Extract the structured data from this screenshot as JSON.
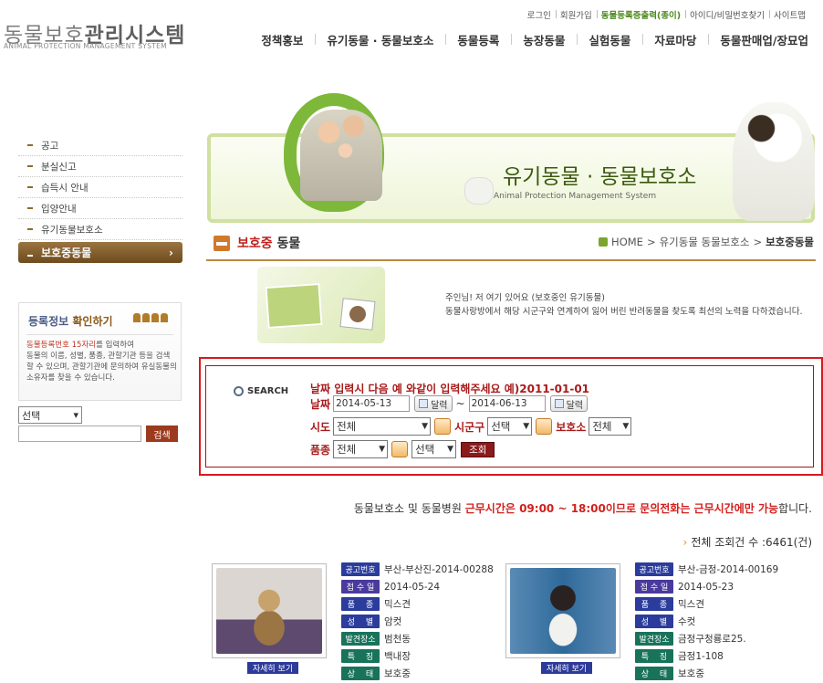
{
  "header": {
    "logo_main_a": "동물보호",
    "logo_main_b": "관리시스템",
    "logo_sub": "ANIMAL PROTECTION MANAGEMENT SYSTEM",
    "util_links": [
      "로그인",
      "회원가입",
      "동물등록증출력(종이)",
      "아이디/비밀번호찾기",
      "사이트맵"
    ],
    "nav": [
      "정책홍보",
      "유기동물 · 동물보호소",
      "동물등록",
      "농장동물",
      "실험동물",
      "자료마당",
      "동물판매업/장묘업"
    ]
  },
  "sidebar": {
    "items": [
      "공고",
      "분실신고",
      "습득시 안내",
      "입양안내",
      "유기동물보호소"
    ],
    "active": "보호중동물",
    "active_arrow": "›",
    "reg_title_a": "등록정보",
    "reg_title_b": "확인하기",
    "reg_line1_red": "동물등록번호 15자리",
    "reg_line1_rest": "를 입력하여",
    "reg_text": "동물의 이름, 성별, 품종, 관할기관 등을 검색할 수 있으며, 관할기관에 문의하여 유실동물의 소유자를 찾을 수 있습니다.",
    "select_value": "선택",
    "search_button": "검색"
  },
  "banner": {
    "title": "유기동물 · 동물보호소",
    "subtitle": "Animal Protection Management System"
  },
  "page": {
    "title_red": "보호중",
    "title_dark": "동물",
    "breadcrumb_home": "HOME",
    "breadcrumb_mid": "유기동물 동물보호소",
    "breadcrumb_current": "보호중동물",
    "intro_line1": "주인님! 저 여기 있어요 (보호중인 유기동물)",
    "intro_line2": "동물사랑방에서 해당 시군구와 연계하여 잃어 버린 반려동물을 찾도록 최선의 노력을 다하겠습니다."
  },
  "search": {
    "label": "SEARCH",
    "hint": "날짜 입력시 다음 예 와같이 입력해주세요 예)2011-01-01",
    "date_label": "날짜",
    "date_from": "2014-05-13",
    "date_to": "2014-06-13",
    "tilde": "~",
    "calendar_button": "달력",
    "sido_label": "시도",
    "sido_value": "전체",
    "sigungu_label": "시군구",
    "sigungu_value": "선택",
    "shelter_label": "보호소",
    "shelter_value": "전체",
    "breed_label": "품종",
    "breed_value": "전체",
    "breed_sub_value": "선택",
    "submit": "조회"
  },
  "notice": {
    "text_a": "동물보호소 및 동물병원 ",
    "text_hl": "근무시간은 09:00 ~ 18:00이므로 문의전화는 근무시간에만 가능",
    "text_b": "합니다."
  },
  "total": {
    "text": "전체 조회건 수 :6461(건)"
  },
  "labels": {
    "notice_no": "공고번호",
    "received": "접 수 일",
    "breed": "품　 종",
    "sex": "성　 별",
    "found": "발견장소",
    "feature": "특　 징",
    "status": "상　 태",
    "detail": "자세히 보기"
  },
  "animals": [
    {
      "notice_no": "부산-부산진-2014-00288",
      "received": "2014-05-24",
      "breed": "믹스견",
      "sex": "암컷",
      "found": "범천동",
      "feature": "백내장",
      "status": "보호중"
    },
    {
      "notice_no": "부산-금정-2014-00169",
      "received": "2014-05-23",
      "breed": "믹스견",
      "sex": "수컷",
      "found": "금정구청룡로25.",
      "feature": "금정1-108",
      "status": "보호중"
    }
  ],
  "colors": {
    "accent_red": "#d9191e",
    "brown": "#8c6a2f",
    "green": "#7db83a",
    "tag_blue": "#2b3c9c",
    "tag_green": "#19735a"
  }
}
